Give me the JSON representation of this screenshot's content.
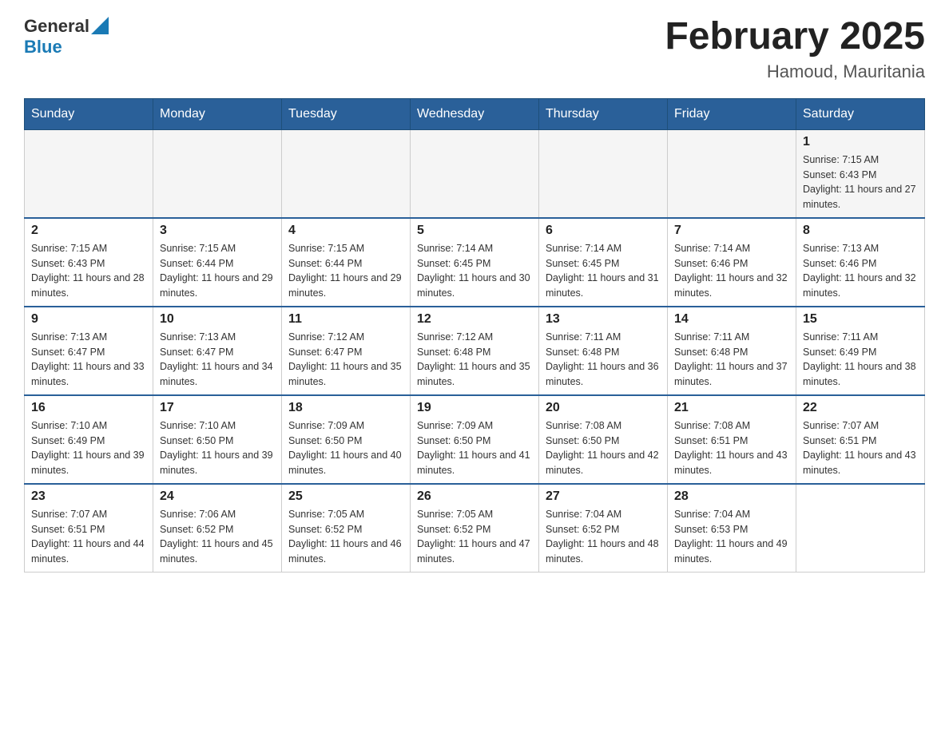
{
  "header": {
    "logo_general": "General",
    "logo_blue": "Blue",
    "month_title": "February 2025",
    "location": "Hamoud, Mauritania"
  },
  "weekdays": [
    "Sunday",
    "Monday",
    "Tuesday",
    "Wednesday",
    "Thursday",
    "Friday",
    "Saturday"
  ],
  "weeks": [
    {
      "days": [
        {
          "date": "",
          "info": ""
        },
        {
          "date": "",
          "info": ""
        },
        {
          "date": "",
          "info": ""
        },
        {
          "date": "",
          "info": ""
        },
        {
          "date": "",
          "info": ""
        },
        {
          "date": "",
          "info": ""
        },
        {
          "date": "1",
          "info": "Sunrise: 7:15 AM\nSunset: 6:43 PM\nDaylight: 11 hours and 27 minutes."
        }
      ]
    },
    {
      "days": [
        {
          "date": "2",
          "info": "Sunrise: 7:15 AM\nSunset: 6:43 PM\nDaylight: 11 hours and 28 minutes."
        },
        {
          "date": "3",
          "info": "Sunrise: 7:15 AM\nSunset: 6:44 PM\nDaylight: 11 hours and 29 minutes."
        },
        {
          "date": "4",
          "info": "Sunrise: 7:15 AM\nSunset: 6:44 PM\nDaylight: 11 hours and 29 minutes."
        },
        {
          "date": "5",
          "info": "Sunrise: 7:14 AM\nSunset: 6:45 PM\nDaylight: 11 hours and 30 minutes."
        },
        {
          "date": "6",
          "info": "Sunrise: 7:14 AM\nSunset: 6:45 PM\nDaylight: 11 hours and 31 minutes."
        },
        {
          "date": "7",
          "info": "Sunrise: 7:14 AM\nSunset: 6:46 PM\nDaylight: 11 hours and 32 minutes."
        },
        {
          "date": "8",
          "info": "Sunrise: 7:13 AM\nSunset: 6:46 PM\nDaylight: 11 hours and 32 minutes."
        }
      ]
    },
    {
      "days": [
        {
          "date": "9",
          "info": "Sunrise: 7:13 AM\nSunset: 6:47 PM\nDaylight: 11 hours and 33 minutes."
        },
        {
          "date": "10",
          "info": "Sunrise: 7:13 AM\nSunset: 6:47 PM\nDaylight: 11 hours and 34 minutes."
        },
        {
          "date": "11",
          "info": "Sunrise: 7:12 AM\nSunset: 6:47 PM\nDaylight: 11 hours and 35 minutes."
        },
        {
          "date": "12",
          "info": "Sunrise: 7:12 AM\nSunset: 6:48 PM\nDaylight: 11 hours and 35 minutes."
        },
        {
          "date": "13",
          "info": "Sunrise: 7:11 AM\nSunset: 6:48 PM\nDaylight: 11 hours and 36 minutes."
        },
        {
          "date": "14",
          "info": "Sunrise: 7:11 AM\nSunset: 6:48 PM\nDaylight: 11 hours and 37 minutes."
        },
        {
          "date": "15",
          "info": "Sunrise: 7:11 AM\nSunset: 6:49 PM\nDaylight: 11 hours and 38 minutes."
        }
      ]
    },
    {
      "days": [
        {
          "date": "16",
          "info": "Sunrise: 7:10 AM\nSunset: 6:49 PM\nDaylight: 11 hours and 39 minutes."
        },
        {
          "date": "17",
          "info": "Sunrise: 7:10 AM\nSunset: 6:50 PM\nDaylight: 11 hours and 39 minutes."
        },
        {
          "date": "18",
          "info": "Sunrise: 7:09 AM\nSunset: 6:50 PM\nDaylight: 11 hours and 40 minutes."
        },
        {
          "date": "19",
          "info": "Sunrise: 7:09 AM\nSunset: 6:50 PM\nDaylight: 11 hours and 41 minutes."
        },
        {
          "date": "20",
          "info": "Sunrise: 7:08 AM\nSunset: 6:50 PM\nDaylight: 11 hours and 42 minutes."
        },
        {
          "date": "21",
          "info": "Sunrise: 7:08 AM\nSunset: 6:51 PM\nDaylight: 11 hours and 43 minutes."
        },
        {
          "date": "22",
          "info": "Sunrise: 7:07 AM\nSunset: 6:51 PM\nDaylight: 11 hours and 43 minutes."
        }
      ]
    },
    {
      "days": [
        {
          "date": "23",
          "info": "Sunrise: 7:07 AM\nSunset: 6:51 PM\nDaylight: 11 hours and 44 minutes."
        },
        {
          "date": "24",
          "info": "Sunrise: 7:06 AM\nSunset: 6:52 PM\nDaylight: 11 hours and 45 minutes."
        },
        {
          "date": "25",
          "info": "Sunrise: 7:05 AM\nSunset: 6:52 PM\nDaylight: 11 hours and 46 minutes."
        },
        {
          "date": "26",
          "info": "Sunrise: 7:05 AM\nSunset: 6:52 PM\nDaylight: 11 hours and 47 minutes."
        },
        {
          "date": "27",
          "info": "Sunrise: 7:04 AM\nSunset: 6:52 PM\nDaylight: 11 hours and 48 minutes."
        },
        {
          "date": "28",
          "info": "Sunrise: 7:04 AM\nSunset: 6:53 PM\nDaylight: 11 hours and 49 minutes."
        },
        {
          "date": "",
          "info": ""
        }
      ]
    }
  ]
}
